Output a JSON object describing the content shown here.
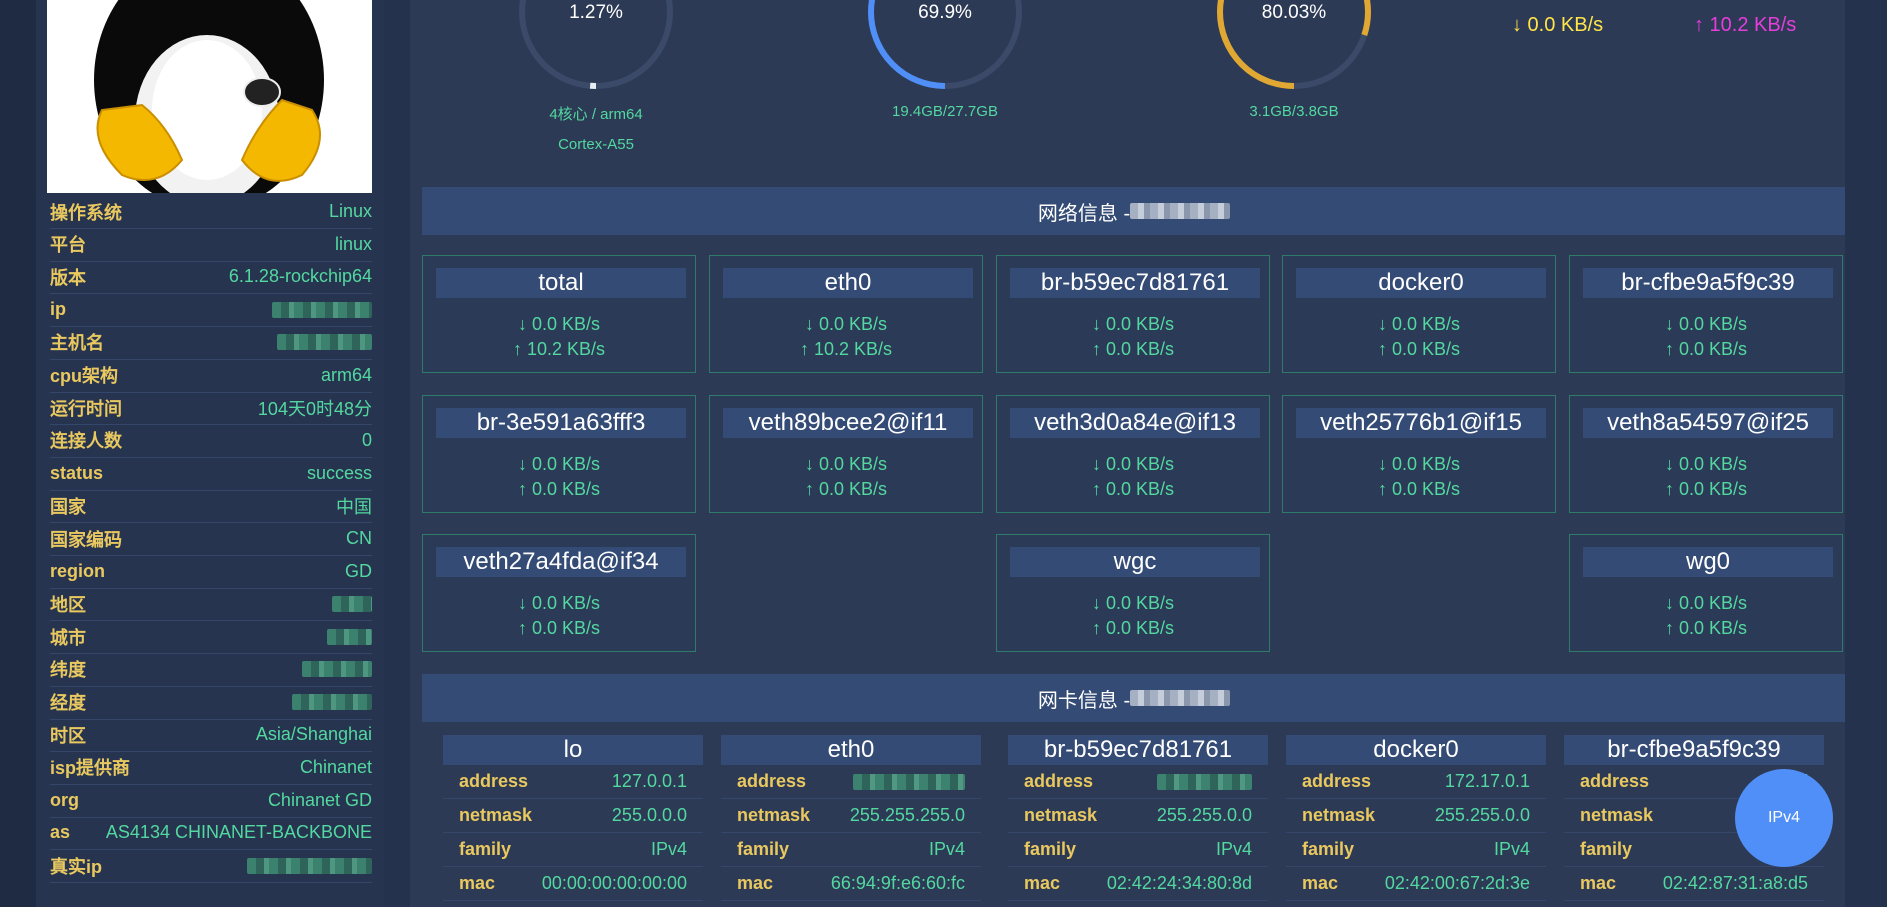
{
  "sidebar": {
    "rows": [
      {
        "key": "操作系统",
        "value": "Linux"
      },
      {
        "key": "平台",
        "value": "linux"
      },
      {
        "key": "版本",
        "value": "6.1.28-rockchip64"
      },
      {
        "key": "ip",
        "value": ""
      },
      {
        "key": "主机名",
        "value": ""
      },
      {
        "key": "cpu架构",
        "value": "arm64"
      },
      {
        "key": "运行时间",
        "value": "104天0时48分"
      },
      {
        "key": "连接人数",
        "value": "0"
      },
      {
        "key": "status",
        "value": "success"
      },
      {
        "key": "国家",
        "value": "中国"
      },
      {
        "key": "国家编码",
        "value": "CN"
      },
      {
        "key": "region",
        "value": "GD"
      },
      {
        "key": "地区",
        "value": ""
      },
      {
        "key": "城市",
        "value": ""
      },
      {
        "key": "纬度",
        "value": ""
      },
      {
        "key": "经度",
        "value": ""
      },
      {
        "key": "时区",
        "value": "Asia/Shanghai"
      },
      {
        "key": "isp提供商",
        "value": "Chinanet"
      },
      {
        "key": "org",
        "value": "Chinanet GD"
      },
      {
        "key": "as",
        "value": "AS4134 CHINANET-BACKBONE"
      },
      {
        "key": "真实ip",
        "value": ""
      }
    ]
  },
  "gauges": [
    {
      "value": "1.27%",
      "percent": 1.27,
      "color": "#e8ecf3",
      "caption1": "4核心 / arm64",
      "caption2": "Cortex-A55"
    },
    {
      "value": "69.9%",
      "percent": 69.9,
      "color": "#4f8ff7",
      "caption1": "19.4GB/27.7GB",
      "caption2": ""
    },
    {
      "value": "80.03%",
      "percent": 80.03,
      "color": "#e0a832",
      "caption1": "3.1GB/3.8GB",
      "caption2": ""
    }
  ],
  "speed": {
    "down": "↓ 0.0 KB/s",
    "up": "↑ 10.2 KB/s"
  },
  "network_section": {
    "title": "网络信息 - "
  },
  "interfaces": [
    {
      "name": "total",
      "down": "↓ 0.0 KB/s",
      "up": "↑ 10.2 KB/s"
    },
    {
      "name": "eth0",
      "down": "↓ 0.0 KB/s",
      "up": "↑ 10.2 KB/s"
    },
    {
      "name": "br-b59ec7d81761",
      "down": "↓ 0.0 KB/s",
      "up": "↑ 0.0 KB/s"
    },
    {
      "name": "docker0",
      "down": "↓ 0.0 KB/s",
      "up": "↑ 0.0 KB/s"
    },
    {
      "name": "br-cfbe9a5f9c39",
      "down": "↓ 0.0 KB/s",
      "up": "↑ 0.0 KB/s"
    },
    {
      "name": "br-3e591a63fff3",
      "down": "↓ 0.0 KB/s",
      "up": "↑ 0.0 KB/s"
    },
    {
      "name": "veth89bcee2@if11",
      "down": "↓ 0.0 KB/s",
      "up": "↑ 0.0 KB/s"
    },
    {
      "name": "veth3d0a84e@if13",
      "down": "↓ 0.0 KB/s",
      "up": "↑ 0.0 KB/s"
    },
    {
      "name": "veth25776b1@if15",
      "down": "↓ 0.0 KB/s",
      "up": "↑ 0.0 KB/s"
    },
    {
      "name": "veth8a54597@if25",
      "down": "↓ 0.0 KB/s",
      "up": "↑ 0.0 KB/s"
    },
    {
      "name": "veth27a4fda@if34",
      "down": "↓ 0.0 KB/s",
      "up": "↑ 0.0 KB/s"
    },
    {
      "name": "wgc",
      "down": "↓ 0.0 KB/s",
      "up": "↑ 0.0 KB/s"
    },
    {
      "name": "wg0",
      "down": "↓ 0.0 KB/s",
      "up": "↑ 0.0 KB/s"
    }
  ],
  "nic_section": {
    "title": "网卡信息 - "
  },
  "nic_cards": [
    {
      "name": "lo",
      "rows": [
        {
          "k": "address",
          "v": "127.0.0.1"
        },
        {
          "k": "netmask",
          "v": "255.0.0.0"
        },
        {
          "k": "family",
          "v": "IPv4"
        },
        {
          "k": "mac",
          "v": "00:00:00:00:00:00"
        }
      ]
    },
    {
      "name": "eth0",
      "rows": [
        {
          "k": "address",
          "v": ""
        },
        {
          "k": "netmask",
          "v": "255.255.255.0"
        },
        {
          "k": "family",
          "v": "IPv4"
        },
        {
          "k": "mac",
          "v": "66:94:9f:e6:60:fc"
        }
      ]
    },
    {
      "name": "br-b59ec7d81761",
      "rows": [
        {
          "k": "address",
          "v": ""
        },
        {
          "k": "netmask",
          "v": "255.255.0.0"
        },
        {
          "k": "family",
          "v": "IPv4"
        },
        {
          "k": "mac",
          "v": "02:42:24:34:80:8d"
        }
      ]
    },
    {
      "name": "docker0",
      "rows": [
        {
          "k": "address",
          "v": "172.17.0.1"
        },
        {
          "k": "netmask",
          "v": "255.255.0.0"
        },
        {
          "k": "family",
          "v": "IPv4"
        },
        {
          "k": "mac",
          "v": "02:42:00:67:2d:3e"
        }
      ]
    },
    {
      "name": "br-cfbe9a5f9c39",
      "rows": [
        {
          "k": "address",
          "v": "17"
        },
        {
          "k": "netmask",
          "v": "255"
        },
        {
          "k": "family",
          "v": "IPv4"
        },
        {
          "k": "mac",
          "v": "02:42:87:31:a8:d5"
        }
      ]
    }
  ],
  "fab": {
    "label": "IPv4"
  }
}
